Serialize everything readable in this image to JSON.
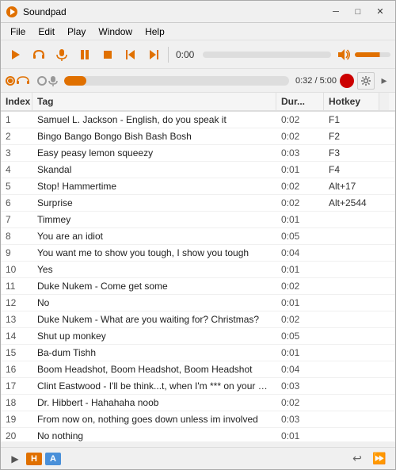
{
  "app": {
    "title": "Soundpad",
    "icon": "🔊"
  },
  "title_bar": {
    "title": "Soundpad",
    "minimize_label": "─",
    "maximize_label": "□",
    "close_label": "✕"
  },
  "menu": {
    "items": [
      "File",
      "Edit",
      "Play",
      "Window",
      "Help"
    ]
  },
  "toolbar1": {
    "play_label": "▶",
    "headphones_label": "🎧",
    "mic_label": "🎤",
    "pause_label": "⏸",
    "stop_label": "⏹",
    "prev_label": "⏮",
    "next_label": "⏭",
    "time": "0:00",
    "volume_icon": "🔊"
  },
  "toolbar2": {
    "time_display": "0:32 / 5:00"
  },
  "table": {
    "headers": [
      "Index",
      "Tag",
      "Dur...",
      "Hotkey"
    ],
    "rows": [
      {
        "index": "1",
        "tag": "Samuel L. Jackson - English, do you speak it",
        "dur": "0:02",
        "hotkey": "F1"
      },
      {
        "index": "2",
        "tag": "Bingo Bango Bongo Bish Bash Bosh",
        "dur": "0:02",
        "hotkey": "F2"
      },
      {
        "index": "3",
        "tag": "Easy peasy lemon squeezy",
        "dur": "0:03",
        "hotkey": "F3"
      },
      {
        "index": "4",
        "tag": "Skandal",
        "dur": "0:01",
        "hotkey": "F4"
      },
      {
        "index": "5",
        "tag": "Stop! Hammertime",
        "dur": "0:02",
        "hotkey": "Alt+17"
      },
      {
        "index": "6",
        "tag": "Surprise",
        "dur": "0:02",
        "hotkey": "Alt+2544"
      },
      {
        "index": "7",
        "tag": "Timmey",
        "dur": "0:01",
        "hotkey": ""
      },
      {
        "index": "8",
        "tag": "You are an idiot",
        "dur": "0:05",
        "hotkey": ""
      },
      {
        "index": "9",
        "tag": "You want me to show you tough, I show you tough",
        "dur": "0:04",
        "hotkey": ""
      },
      {
        "index": "10",
        "tag": "Yes",
        "dur": "0:01",
        "hotkey": ""
      },
      {
        "index": "11",
        "tag": "Duke Nukem - Come get some",
        "dur": "0:02",
        "hotkey": ""
      },
      {
        "index": "12",
        "tag": "No",
        "dur": "0:01",
        "hotkey": ""
      },
      {
        "index": "13",
        "tag": "Duke Nukem - What are you waiting for? Christmas?",
        "dur": "0:02",
        "hotkey": ""
      },
      {
        "index": "14",
        "tag": "Shut up monkey",
        "dur": "0:05",
        "hotkey": ""
      },
      {
        "index": "15",
        "tag": "Ba-dum Tishh",
        "dur": "0:01",
        "hotkey": ""
      },
      {
        "index": "16",
        "tag": "Boom Headshot, Boom Headshot, Boom Headshot",
        "dur": "0:04",
        "hotkey": ""
      },
      {
        "index": "17",
        "tag": "Clint Eastwood - I'll be think...t, when I'm *** on your grave",
        "dur": "0:03",
        "hotkey": ""
      },
      {
        "index": "18",
        "tag": "Dr. Hibbert - Hahahaha noob",
        "dur": "0:02",
        "hotkey": ""
      },
      {
        "index": "19",
        "tag": "From now on, nothing goes down unless im involved",
        "dur": "0:03",
        "hotkey": ""
      },
      {
        "index": "20",
        "tag": "No nothing",
        "dur": "0:01",
        "hotkey": ""
      }
    ]
  },
  "status_bar": {
    "play_label": "▶",
    "badge_h": "H",
    "badge_a": "A",
    "replay_label": "↩",
    "forward_label": "⏩"
  }
}
